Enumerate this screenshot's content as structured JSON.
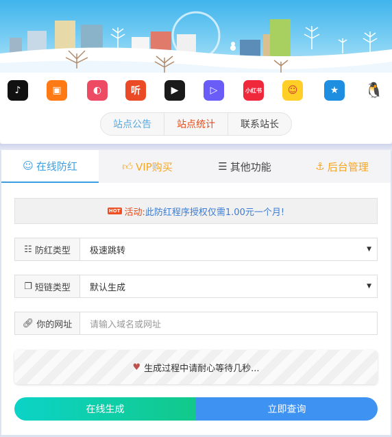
{
  "apps": [
    {
      "name": "tiktok-icon",
      "bg": "#111111",
      "glyph": "♪"
    },
    {
      "name": "kuaishou-icon",
      "bg": "#ff7a14",
      "glyph": "▣"
    },
    {
      "name": "netease-music-icon",
      "bg": "#ec4b63",
      "glyph": "◐"
    },
    {
      "name": "ting-icon",
      "bg": "#ea4b26",
      "glyph": "听"
    },
    {
      "name": "video-play-icon",
      "bg": "#1a1a1a",
      "glyph": "▶"
    },
    {
      "name": "weishi-icon",
      "bg": "#6a5cf6",
      "glyph": "▷"
    },
    {
      "name": "xiaohongshu-icon",
      "bg": "#f0283c",
      "glyph": "小红书"
    },
    {
      "name": "kuaikan-icon",
      "bg": "#ffcf28",
      "glyph": "☺"
    },
    {
      "name": "qzone-icon",
      "bg": "#1e8fe0",
      "glyph": "★"
    },
    {
      "name": "qq-icon",
      "bg": "#ffffff",
      "glyph": "🐧"
    }
  ],
  "site_nav": {
    "notice": "站点公告",
    "stats": "站点统计",
    "contact": "联系站长"
  },
  "tabs": {
    "online": "在线防红",
    "vip": "VIP购买",
    "other": "其他功能",
    "admin": "后台管理"
  },
  "notice": {
    "badge": "HOT",
    "label": "活动:",
    "text": "此防红程序授权仅需1.00元一个月!"
  },
  "form": {
    "type_label": "防红类型",
    "type_value": "极速跳转",
    "short_label": "短链类型",
    "short_value": "默认生成",
    "url_label": "你的网址",
    "url_placeholder": "请输入域名或网址"
  },
  "wait_text": "生成过程中请耐心等待几秒...",
  "buttons": {
    "generate": "在线生成",
    "query": "立即查询"
  },
  "colors": {
    "accent": "#3c9de0",
    "orange": "#f5a623",
    "red_text": "#e64a19"
  }
}
